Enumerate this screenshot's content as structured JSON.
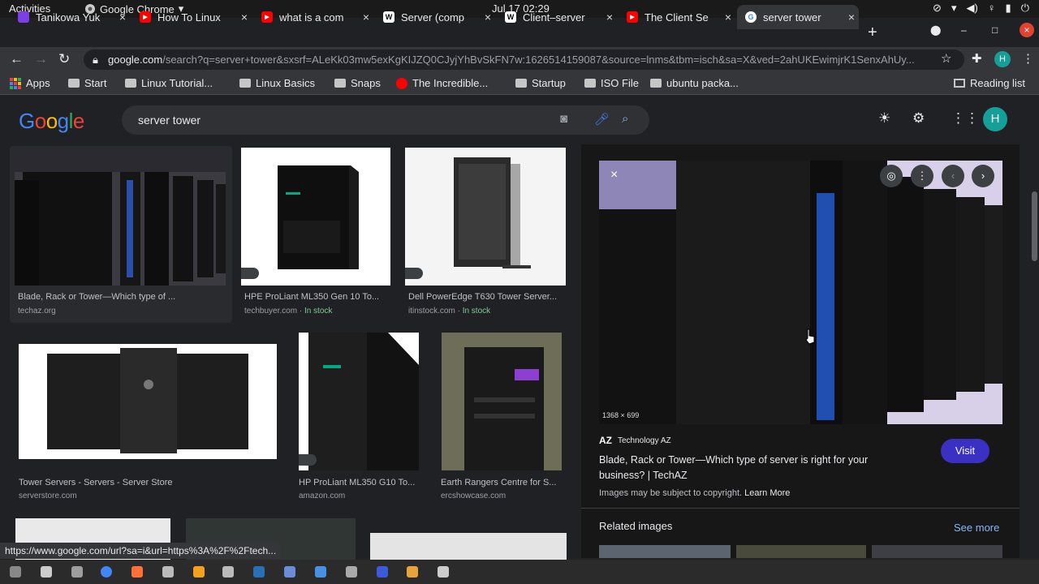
{
  "system_bar": {
    "activities": "Activities",
    "app_name": "Google Chrome",
    "clock": "Jul 17  02:29"
  },
  "tabs": [
    {
      "title": "Tanikowa Yuk",
      "favicon": "wave-icon",
      "color": "#7b3fe4"
    },
    {
      "title": "How To Linux",
      "favicon": "youtube-icon",
      "color": "#ff0000"
    },
    {
      "title": "what is a com",
      "favicon": "youtube-icon",
      "color": "#ff0000"
    },
    {
      "title": "Server (comp",
      "favicon": "wikipedia-icon",
      "color": "#ffffff"
    },
    {
      "title": "Client–server",
      "favicon": "wikipedia-icon",
      "color": "#ffffff"
    },
    {
      "title": "The Client Se",
      "favicon": "youtube-icon",
      "color": "#ff0000"
    },
    {
      "title": "server tower",
      "favicon": "google-icon",
      "color": "#4285f4"
    }
  ],
  "address_bar": {
    "domain": "google.com",
    "path": "/search?q=server+tower&sxsrf=ALeKk03mw5exKgKIJZQ0CJyjYhBvSkFN7w:1626514159087&source=lnms&tbm=isch&sa=X&ved=2ahUKEwimjrK1SenxAhUy..."
  },
  "bookmarks": {
    "apps": "Apps",
    "items": [
      "Start",
      "Linux Tutorial...",
      "Linux Basics",
      "Snaps",
      "The Incredible...",
      "Startup",
      "ISO File",
      "ubuntu packa..."
    ],
    "reading_list": "Reading list"
  },
  "google": {
    "logo_letters": [
      {
        "ch": "G",
        "color": "#4285f4"
      },
      {
        "ch": "o",
        "color": "#ea4335"
      },
      {
        "ch": "o",
        "color": "#fbbc05"
      },
      {
        "ch": "g",
        "color": "#4285f4"
      },
      {
        "ch": "l",
        "color": "#34a853"
      },
      {
        "ch": "e",
        "color": "#ea4335"
      }
    ],
    "query": "server tower",
    "avatar_letter": "H"
  },
  "results": [
    {
      "caption": "Blade, Rack or Tower—Which type of ...",
      "source": "techaz.org",
      "stock": ""
    },
    {
      "caption": "HPE ProLiant ML350 Gen 10 To...",
      "source": "techbuyer.com",
      "stock": "In stock"
    },
    {
      "caption": "Dell PowerEdge T630 Tower Server...",
      "source": "itinstock.com",
      "stock": "In stock"
    },
    {
      "caption": "Tower Servers - Servers - Server Store",
      "source": "serverstore.com",
      "stock": ""
    },
    {
      "caption": "HP ProLiant ML350 G10 To...",
      "source": "amazon.com",
      "stock": ""
    },
    {
      "caption": "Earth Rangers Centre for S...",
      "source": "ercshowcase.com",
      "stock": ""
    }
  ],
  "preview": {
    "dimensions": "1368 × 699",
    "site_badge": "AZ",
    "site_name": "Technology AZ",
    "title_line1": "Blade, Rack or Tower—Which type of server is right for your",
    "title_line2": "business? | TechAZ",
    "visit": "Visit",
    "copyright": "Images may be subject to copyright.",
    "learn_more": "Learn More",
    "related": "Related images",
    "see_more": "See more"
  },
  "status_url": "https://www.google.com/url?sa=i&url=https%3A%2F%2Ftech...",
  "taskbar_icons": [
    "#888888",
    "#cccccc",
    "#9e9e9e",
    "#4285f4",
    "#ff7139",
    "#bbbbbb",
    "#f4a120",
    "#bbbbbb",
    "#2a6fb5",
    "#6b8cd6",
    "#4a90e2",
    "#aaaaaa",
    "#3b5bdb",
    "#e8a33d",
    "#cccccc"
  ]
}
